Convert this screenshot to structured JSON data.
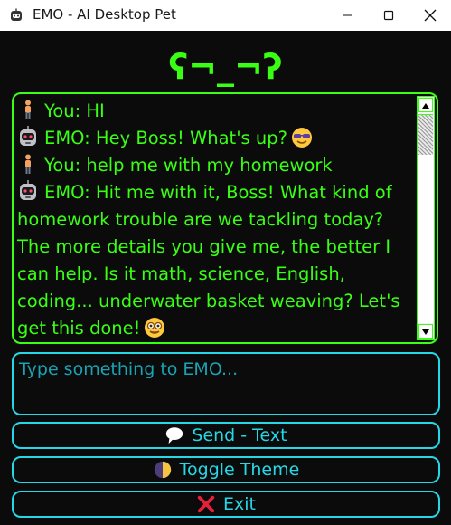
{
  "window": {
    "title": "EMO - AI Desktop Pet"
  },
  "face": "ʕ¬_¬ʔ",
  "chat": {
    "messages": [
      {
        "speaker": "user",
        "text": "You: HI"
      },
      {
        "speaker": "emo",
        "text": "EMO: Hey Boss! What's up?",
        "trailing_emoji": "sunglasses-emoji"
      },
      {
        "speaker": "user",
        "text": "You: help me  with my homework"
      },
      {
        "speaker": "emo",
        "text": "EMO: Hit me with it, Boss! What kind of homework trouble are we tackling today? The more details you give me, the better I can help.  Is it math, science, English, coding... underwater basket weaving?  Let's get this done!",
        "trailing_emoji": "nerd-emoji"
      }
    ]
  },
  "input": {
    "placeholder": "Type something to EMO..."
  },
  "buttons": {
    "send": "Send - Text",
    "toggle_theme": "Toggle Theme",
    "exit": "Exit"
  },
  "colors": {
    "green": "#39ff14",
    "cyan": "#25d8e8",
    "background": "#0b0b0b"
  }
}
